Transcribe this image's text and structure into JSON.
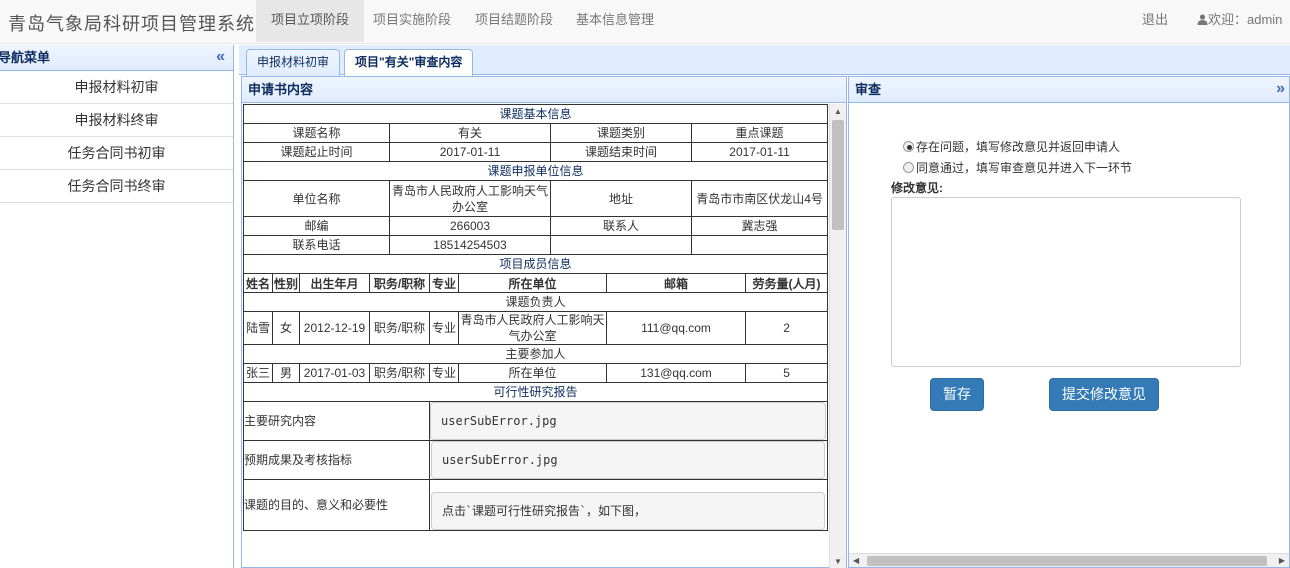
{
  "navbar": {
    "brand": "青岛气象局科研项目管理系统",
    "items": [
      "项目立项阶段",
      "项目实施阶段",
      "项目结题阶段",
      "基本信息管理"
    ],
    "logout": "退出",
    "welcome": "欢迎：admin"
  },
  "sidebar": {
    "title": "导航菜单",
    "items": [
      "申报材料初审",
      "申报材料终审",
      "任务合同书初审",
      "任务合同书终审"
    ]
  },
  "tabs": [
    "申报材料初审",
    "项目\"有关\"审查内容"
  ],
  "application": {
    "panel_title": "申请书内容",
    "basic_section": "课题基本信息",
    "topic_name_label": "课题名称",
    "topic_name": "有关",
    "topic_type_label": "课题类别",
    "topic_type": "重点课题",
    "start_label": "课题起止时间",
    "start_date": "2017-01-11",
    "end_label": "课题结束时间",
    "end_date": "2017-01-11",
    "unit_section": "课题申报单位信息",
    "unit_name_label": "单位名称",
    "unit_name": "青岛市人民政府人工影响天气办公室",
    "address_label": "地址",
    "address": "青岛市市南区伏龙山4号",
    "postcode_label": "邮编",
    "postcode": "266003",
    "contact_label": "联系人",
    "contact": "冀志强",
    "phone_label": "联系电话",
    "phone": "18514254503",
    "members_section": "项目成员信息",
    "member_headers": [
      "姓名",
      "性别",
      "出生年月",
      "职务/职称",
      "专业",
      "所在单位",
      "邮箱",
      "劳务量(人月)"
    ],
    "leader_section": "课题负责人",
    "leader": [
      "陆雪",
      "女",
      "2012-12-19",
      "职务/职称",
      "专业",
      "青岛市人民政府人工影响天气办公室",
      "111@qq.com",
      "2"
    ],
    "participant_section": "主要参加人",
    "participant": [
      "张三",
      "男",
      "2017-01-03",
      "职务/职称",
      "专业",
      "所在单位",
      "131@qq.com",
      "5"
    ],
    "feasibility_section": "可行性研究报告",
    "docs": [
      {
        "label": "主要研究内容",
        "value": "userSubError.jpg"
      },
      {
        "label": "预期成果及考核指标",
        "value": "userSubError.jpg"
      },
      {
        "label": "课题的目的、意义和必要性",
        "value": "点击`课题可行性研究报告`，如下图，"
      }
    ]
  },
  "review": {
    "panel_title": "审查",
    "option1": "存在问题，填写修改意见并返回申请人",
    "option2": "同意通过，填写审查意见并进入下一环节",
    "opinion_label": "修改意见:",
    "opinion_value": "",
    "save_button": "暂存",
    "submit_button": "提交修改意见"
  }
}
